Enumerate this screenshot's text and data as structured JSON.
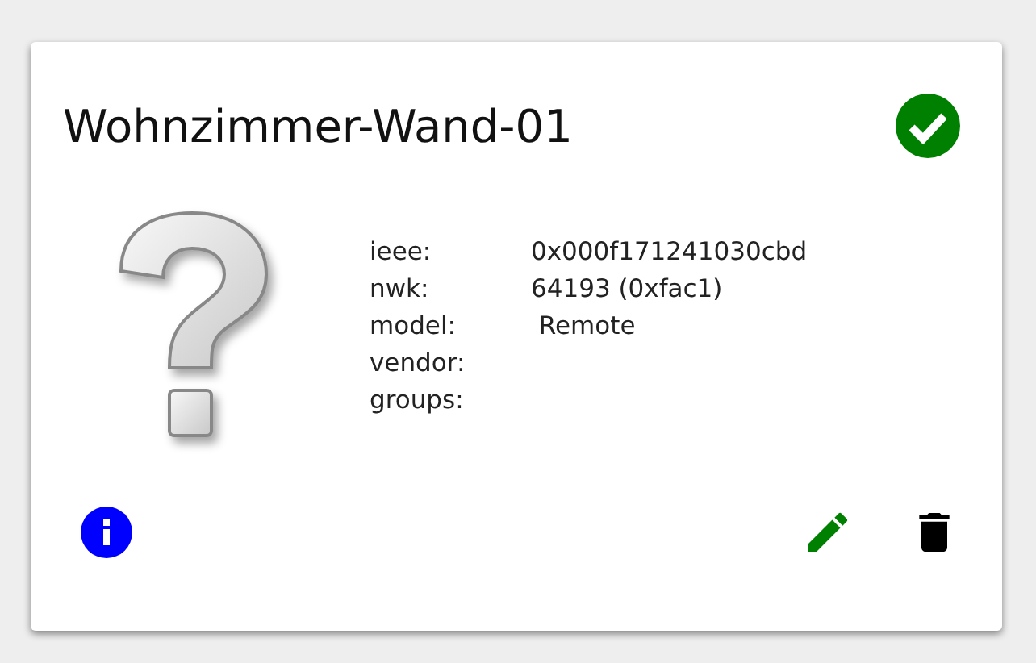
{
  "device": {
    "title": "Wohnzimmer-Wand-01",
    "online": true
  },
  "properties": [
    {
      "label": "ieee:",
      "value": "0x000f171241030cbd"
    },
    {
      "label": "nwk:",
      "value": "64193 (0xfac1)"
    },
    {
      "label": "model:",
      "value": " Remote"
    },
    {
      "label": "vendor:"
    },
    {
      "label": "groups:"
    }
  ]
}
